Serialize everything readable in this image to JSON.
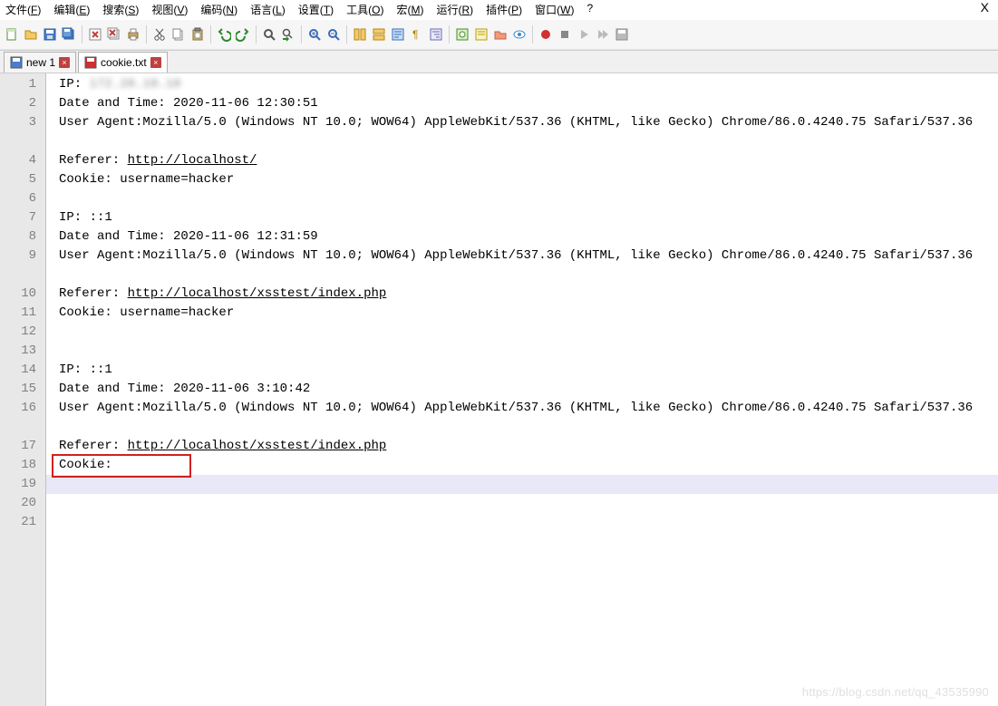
{
  "menubar": {
    "items": [
      {
        "label": "文件(F)",
        "u": "F"
      },
      {
        "label": "编辑(E)",
        "u": "E"
      },
      {
        "label": "搜索(S)",
        "u": "S"
      },
      {
        "label": "视图(V)",
        "u": "V"
      },
      {
        "label": "编码(N)",
        "u": "N"
      },
      {
        "label": "语言(L)",
        "u": "L"
      },
      {
        "label": "设置(T)",
        "u": "T"
      },
      {
        "label": "工具(O)",
        "u": "O"
      },
      {
        "label": "宏(M)",
        "u": "M"
      },
      {
        "label": "运行(R)",
        "u": "R"
      },
      {
        "label": "插件(P)",
        "u": "P"
      },
      {
        "label": "窗口(W)",
        "u": "W"
      },
      {
        "label": "?",
        "u": ""
      }
    ]
  },
  "tabs": [
    {
      "label": "new 1",
      "active": false,
      "dirty": false,
      "icon": "blue"
    },
    {
      "label": "cookie.txt",
      "active": true,
      "dirty": true,
      "icon": "red"
    }
  ],
  "gutter": {
    "count": 21
  },
  "code": {
    "lines": [
      {
        "n": 1,
        "wrap": false,
        "text": "IP: ",
        "blurred": "172.20.10.10"
      },
      {
        "n": 2,
        "wrap": false,
        "text": "Date and Time: 2020-11-06 12:30:51"
      },
      {
        "n": 3,
        "wrap": true,
        "text": "User Agent:Mozilla/5.0 (Windows NT 10.0; WOW64) AppleWebKit/537.36 (KHTML, like Gecko) Chrome/86.0.4240.75 Safari/537.36"
      },
      {
        "n": 4,
        "wrap": false,
        "text": "Referer: ",
        "link": "http://localhost/"
      },
      {
        "n": 5,
        "wrap": false,
        "text": "Cookie: username=hacker"
      },
      {
        "n": 6,
        "wrap": false,
        "text": ""
      },
      {
        "n": 7,
        "wrap": false,
        "text": "IP: ::1"
      },
      {
        "n": 8,
        "wrap": false,
        "text": "Date and Time: 2020-11-06 12:31:59"
      },
      {
        "n": 9,
        "wrap": true,
        "text": "User Agent:Mozilla/5.0 (Windows NT 10.0; WOW64) AppleWebKit/537.36 (KHTML, like Gecko) Chrome/86.0.4240.75 Safari/537.36"
      },
      {
        "n": 10,
        "wrap": false,
        "text": "Referer: ",
        "link": "http://localhost/xsstest/index.php"
      },
      {
        "n": 11,
        "wrap": false,
        "text": "Cookie: username=hacker"
      },
      {
        "n": 12,
        "wrap": false,
        "text": ""
      },
      {
        "n": 13,
        "wrap": false,
        "text": ""
      },
      {
        "n": 14,
        "wrap": false,
        "text": "IP: ::1"
      },
      {
        "n": 15,
        "wrap": false,
        "text": "Date and Time: 2020-11-06 3:10:42"
      },
      {
        "n": 16,
        "wrap": true,
        "text": "User Agent:Mozilla/5.0 (Windows NT 10.0; WOW64) AppleWebKit/537.36 (KHTML, like Gecko) Chrome/86.0.4240.75 Safari/537.36"
      },
      {
        "n": 17,
        "wrap": false,
        "text": "Referer: ",
        "link": "http://localhost/xsstest/index.php"
      },
      {
        "n": 18,
        "wrap": false,
        "text": "Cookie: ",
        "boxed": true
      },
      {
        "n": 19,
        "wrap": false,
        "text": "",
        "current": true
      },
      {
        "n": 20,
        "wrap": false,
        "text": ""
      },
      {
        "n": 21,
        "wrap": false,
        "text": ""
      }
    ]
  },
  "watermark": "https://blog.csdn.net/qq_43535990",
  "colors": {
    "gutter_bg": "#e8e8e8",
    "gutter_fg": "#808080",
    "current_line_bg": "#e8e8f8",
    "highlight_box": "#d02020"
  }
}
